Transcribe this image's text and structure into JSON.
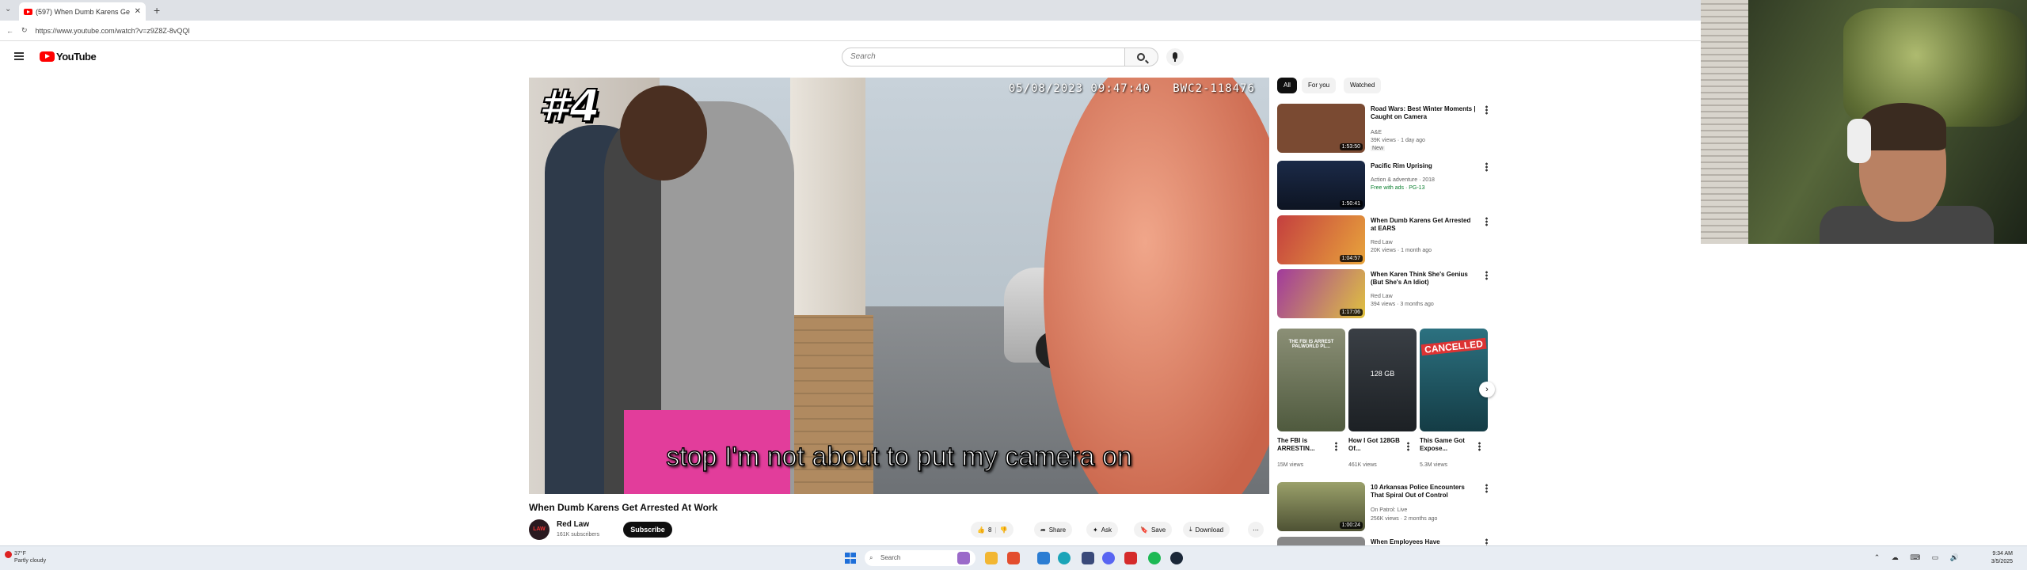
{
  "browser": {
    "tab_title": "(597) When Dumb Karens Ge",
    "url": "https://www.youtube.com/watch?v=z9Z8Z-8vQQI"
  },
  "youtube": {
    "logo": "YouTube",
    "search_placeholder": "Search"
  },
  "video": {
    "overlay_number": "#4",
    "timestamp": "05/08/2023 09:47:40",
    "camera_id": "BWC2-118476",
    "caption": "stop I'm not about to put my camera on",
    "title": "When Dumb Karens Get Arrested At Work",
    "channel": "Red Law",
    "channel_avatar_text": "LAW",
    "subscribers": "161K subscribers",
    "subscribe_label": "Subscribe",
    "likes": "8",
    "share_label": "Share",
    "ask_label": "Ask",
    "save_label": "Save",
    "download_label": "Download"
  },
  "sidebar": {
    "chips": [
      "All",
      "For you",
      "Watched"
    ],
    "recs": [
      {
        "title": "Road Wars: Best Winter Moments | Caught on Camera",
        "channel": "A&E",
        "meta": "39K views · 1 day ago",
        "badge": "New",
        "duration": "1:53:50",
        "thumb_color": "#7a4a32"
      },
      {
        "title": "Pacific Rim Uprising",
        "channel": "Action & adventure · 2018",
        "meta": "Free with ads · PG-13",
        "badge": "",
        "duration": "1:50:41",
        "thumb_color": "#1b2a48"
      },
      {
        "title": "When Dumb Karens Get Arrested at EARS",
        "channel": "Red Law",
        "meta": "20K views · 1 month ago",
        "badge": "",
        "duration": "1:04:57",
        "thumb_color": "#c43f3f"
      },
      {
        "title": "When Karen Think She's Genius (But She's An Idiot)",
        "channel": "Red Law",
        "meta": "394 views · 3 months ago",
        "badge": "",
        "duration": "1:17:06",
        "thumb_color": "#a13a9c"
      },
      {
        "title": "10 Arkansas Police Encounters That Spiral Out of Control",
        "channel": "On Patrol: Live",
        "meta": "256K views · 2 months ago",
        "badge": "",
        "duration": "1:00:24",
        "thumb_color": "#6b6a3f"
      },
      {
        "title": "When Employees Have",
        "channel": "",
        "meta": "",
        "badge": "",
        "duration": "",
        "thumb_color": "#888"
      }
    ],
    "shorts": [
      {
        "title": "The FBI is ARRESTIN...",
        "views": "15M views",
        "thumb_color": "#8b8f76"
      },
      {
        "title": "How I Got 128GB Of...",
        "views": "461K views",
        "thumb_color": "#3a3f45"
      },
      {
        "title": "This Game Got Expose...",
        "views": "5.3M views",
        "thumb_color": "#2c7180"
      }
    ],
    "shorts_overlay": [
      "THE FBI IS ARREST PALWORLD PL...",
      "128 GB",
      "CANCELLED"
    ]
  },
  "taskbar": {
    "weather_temp": "37°F",
    "weather_desc": "Partly cloudy",
    "search_label": "Search",
    "time": "9:34 AM",
    "date": "3/5/2025"
  }
}
